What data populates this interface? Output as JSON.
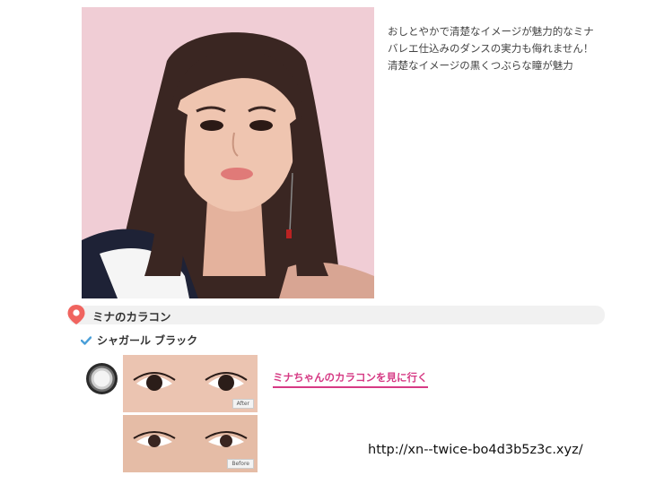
{
  "description": {
    "lines": [
      "おしとやかで清楚なイメージが魅力的なミナ",
      "バレエ仕込みのダンスの実力も侮れません！",
      "清楚なイメージの黒くつぶらな瞳が魅力"
    ]
  },
  "section": {
    "title": "ミナのカラコン",
    "icon": "map-pin-icon",
    "accent_color": "#f0645f"
  },
  "product": {
    "name": "シャガール ブラック",
    "check_color": "#4a9fd8"
  },
  "photos": {
    "after_label": "After",
    "before_label": "Before"
  },
  "link": {
    "label": "ミナちゃんのカラコンを見に行く",
    "color": "#d63a84"
  },
  "url": "http://xn--twice-bo4d3b5z3c.xyz/"
}
